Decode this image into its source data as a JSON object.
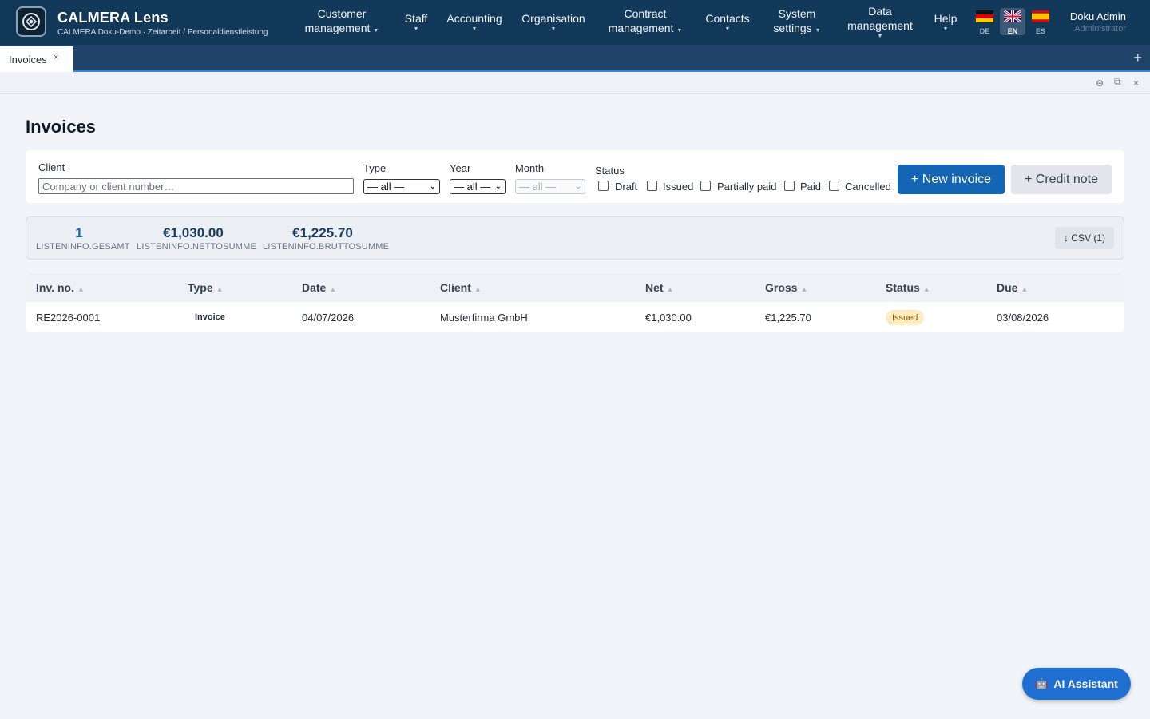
{
  "app": {
    "name": "CALMERA Lens",
    "subtitle": "CALMERA Doku-Demo · Zeitarbeit / Personaldienstleistung"
  },
  "nav": [
    {
      "line1": "Customer",
      "line2": "management"
    },
    {
      "line1": "Staff",
      "line2": ""
    },
    {
      "line1": "Accounting",
      "line2": ""
    },
    {
      "line1": "Organisation",
      "line2": ""
    },
    {
      "line1": "Contract",
      "line2": "management"
    },
    {
      "line1": "Contacts",
      "line2": ""
    },
    {
      "line1": "System",
      "line2": "settings"
    },
    {
      "line1": "Data",
      "line2": "management"
    },
    {
      "line1": "Help",
      "line2": ""
    }
  ],
  "languages": [
    {
      "code": "DE",
      "active": false
    },
    {
      "code": "EN",
      "active": true
    },
    {
      "code": "ES",
      "active": false
    }
  ],
  "user": {
    "name": "Doku Admin",
    "role": "Administrator"
  },
  "tabs": {
    "active_label": "Invoices",
    "close_glyph": "×",
    "add_glyph": "+"
  },
  "window_controls": {
    "minimize": "⊖",
    "restore": "⧉",
    "close": "×"
  },
  "page": {
    "title": "Invoices"
  },
  "filters": {
    "client_label": "Client",
    "client_placeholder": "Company or client number…",
    "client_value": "",
    "type_label": "Type",
    "type_value": "— all —",
    "year_label": "Year",
    "year_value": "— all —",
    "month_label": "Month",
    "month_value": "— all —",
    "status_label": "Status",
    "statuses": [
      {
        "label": "Draft",
        "checked": false
      },
      {
        "label": "Issued",
        "checked": false
      },
      {
        "label": "Partially paid",
        "checked": false
      },
      {
        "label": "Paid",
        "checked": false
      },
      {
        "label": "Cancelled",
        "checked": false
      }
    ],
    "new_invoice_label": "+ New invoice",
    "credit_note_label": "+ Credit note"
  },
  "summary": {
    "count_value": "1",
    "count_label": "LISTENINFO.GESAMT",
    "net_value": "€1,030.00",
    "net_label": "LISTENINFO.NETTOSUMME",
    "gross_value": "€1,225.70",
    "gross_label": "LISTENINFO.BRUTTOSUMME",
    "csv_label": "↓ CSV (1)"
  },
  "table": {
    "sort_glyph": "▲",
    "columns": [
      "Inv. no.",
      "Type",
      "Date",
      "Client",
      "Net",
      "Gross",
      "Status",
      "Due"
    ],
    "rows": [
      {
        "inv_no": "RE2026-0001",
        "type": "Invoice",
        "date": "04/07/2026",
        "client": "Musterfirma GmbH",
        "net": "€1,030.00",
        "gross": "€1,225.70",
        "status": "Issued",
        "due": "03/08/2026"
      }
    ]
  },
  "assistant": {
    "label": "AI Assistant",
    "icon": "robot-icon"
  },
  "colors": {
    "topbar": "#12395a",
    "accent": "#1565b5",
    "status_issued_bg": "#fdecc2"
  }
}
